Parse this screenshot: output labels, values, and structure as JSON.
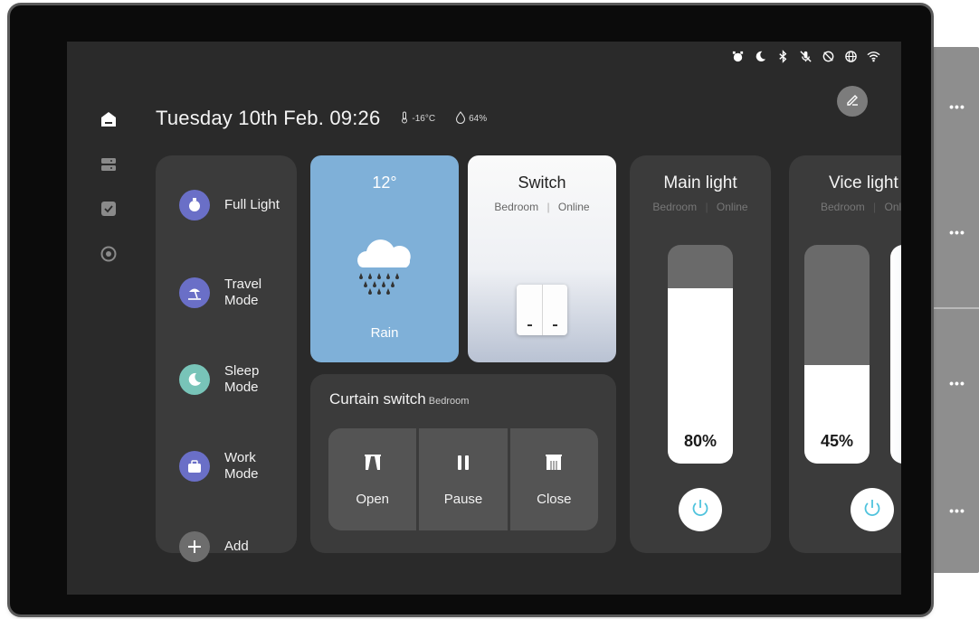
{
  "header": {
    "datetime": "Tuesday 10th Feb. 09:26",
    "temperature": "-16°C",
    "humidity": "64%"
  },
  "status_icons": [
    "alarm-icon",
    "moon-icon",
    "bluetooth-icon",
    "mic-off-icon",
    "do-not-disturb-icon",
    "globe-icon",
    "wifi-icon"
  ],
  "nav": [
    "home-icon",
    "devices-icon",
    "tasks-icon",
    "camera-icon"
  ],
  "scenes": [
    {
      "line1": "Full Light",
      "line2": "",
      "color": "#6a6fc7",
      "icon": "bulb-icon"
    },
    {
      "line1": "Travel",
      "line2": "Mode",
      "color": "#6a6fc7",
      "icon": "beach-icon"
    },
    {
      "line1": "Sleep",
      "line2": "Mode",
      "color": "#78c4b8",
      "icon": "moon-icon"
    },
    {
      "line1": "Work",
      "line2": "Mode",
      "color": "#6a6fc7",
      "icon": "briefcase-icon"
    },
    {
      "line1": "Add",
      "line2": "",
      "color": "#6d6d6d",
      "icon": "plus-icon"
    }
  ],
  "weather": {
    "temperature": "12°",
    "condition": "Rain"
  },
  "switch_card": {
    "title": "Switch",
    "room": "Bedroom",
    "status": "Online",
    "separator": "|"
  },
  "curtain": {
    "title": "Curtain switch",
    "room": "Bedroom",
    "buttons": [
      {
        "label": "Open",
        "icon": "curtain-open-icon"
      },
      {
        "label": "Pause",
        "icon": "pause-icon"
      },
      {
        "label": "Close",
        "icon": "curtain-close-icon"
      }
    ]
  },
  "lights": [
    {
      "title": "Main light",
      "room": "Bedroom",
      "status": "Online",
      "separator": "|",
      "level_label": "80%",
      "level": 0.8
    },
    {
      "title": "Vice light",
      "room": "Bedroom",
      "status": "Online",
      "separator": "|",
      "level_label": "45%",
      "level": 0.45
    }
  ],
  "side_panel_more": [
    "•••",
    "•••",
    "•••",
    "•••"
  ]
}
